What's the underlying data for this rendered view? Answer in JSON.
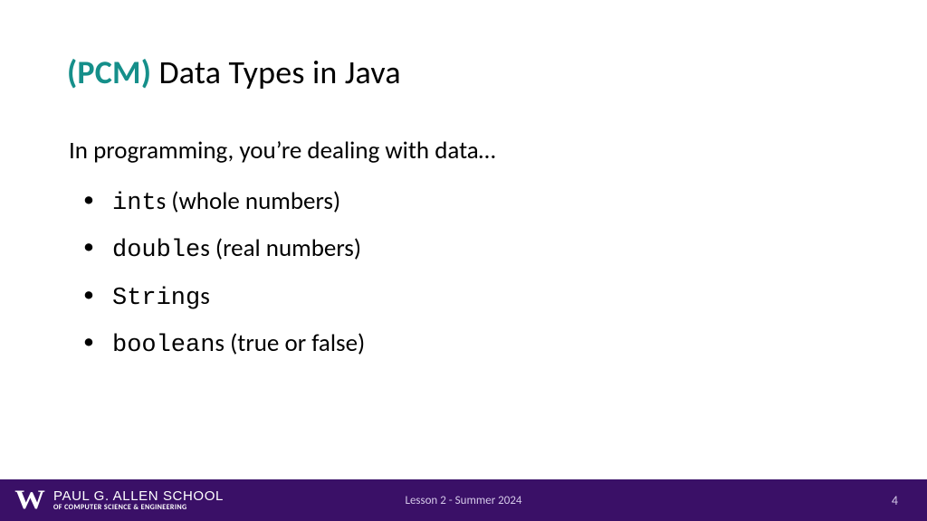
{
  "header": {
    "pcm": "(PCM)",
    "title_rest": " Data Types in Java"
  },
  "intro": "In programming, you’re dealing with data…",
  "bullets": [
    {
      "code": "int",
      "suffix": "s",
      "desc": " (whole numbers)"
    },
    {
      "code": "double",
      "suffix": "s",
      "desc": " (real numbers)"
    },
    {
      "code": "String",
      "suffix": "s",
      "desc": ""
    },
    {
      "code": "boolean",
      "suffix": "s",
      "desc": " (true or false)"
    }
  ],
  "footer": {
    "logo_letter": "W",
    "school_main": "PAUL G. ALLEN SCHOOL",
    "school_sub": "OF COMPUTER SCIENCE & ENGINEERING",
    "lesson": "Lesson 2 - Summer 2024",
    "page": "4"
  }
}
